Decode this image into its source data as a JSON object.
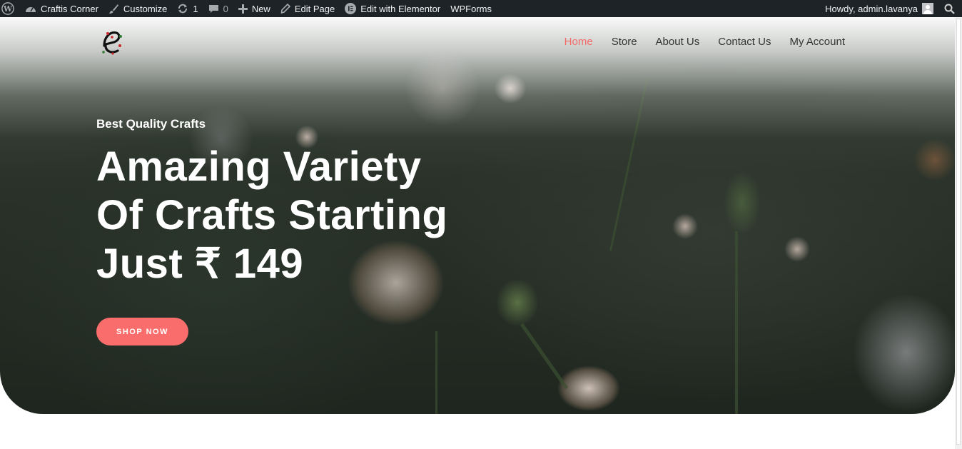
{
  "adminbar": {
    "wp_logo_icon": "wordpress-icon",
    "site_name": "Craftis Corner",
    "customize": "Customize",
    "updates_count": "1",
    "comments_count": "0",
    "new_label": "New",
    "edit_page": "Edit Page",
    "elementor": "Edit with Elementor",
    "wpforms": "WPForms",
    "howdy": "Howdy, admin.lavanya"
  },
  "header": {
    "nav": [
      {
        "label": "Home",
        "active": true
      },
      {
        "label": "Store",
        "active": false
      },
      {
        "label": "About Us",
        "active": false
      },
      {
        "label": "Contact Us",
        "active": false
      },
      {
        "label": "My Account",
        "active": false
      }
    ]
  },
  "hero": {
    "tagline": "Best Quality Crafts",
    "headline_lines": [
      "Amazing Variety",
      "Of Crafts Starting",
      "Just ₹ 149"
    ],
    "cta": "SHOP NOW"
  },
  "colors": {
    "adminbar_bg": "#1d2327",
    "accent": "#f96e6d",
    "nav_active": "#f26b68"
  }
}
